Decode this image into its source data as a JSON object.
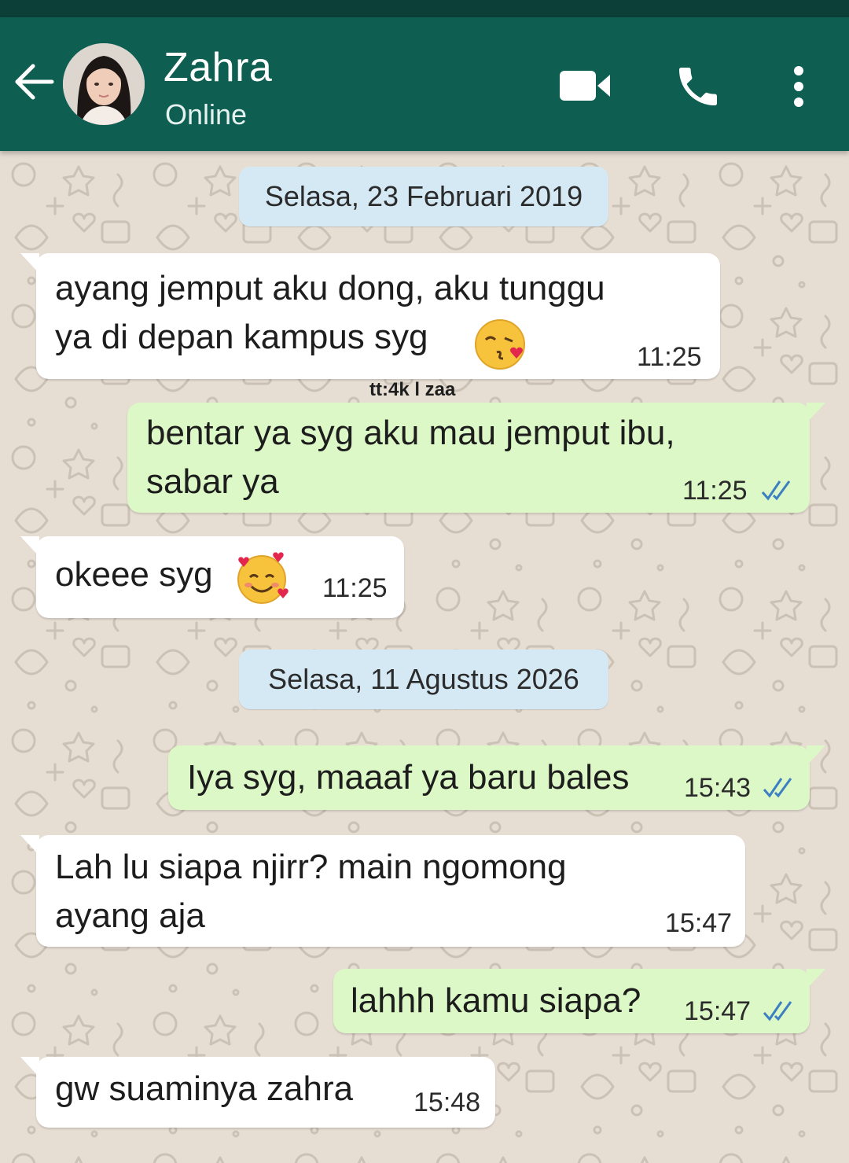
{
  "header": {
    "contact_name": "Zahra",
    "contact_status": "Online"
  },
  "icons": {
    "back": "arrow-left-icon",
    "avatar": "profile-photo",
    "video": "video-camera-icon",
    "call": "phone-icon",
    "menu": "vertical-dots-icon",
    "read_receipt": "double-check-icon",
    "emoji_kiss": "face-blowing-kiss-emoji",
    "emoji_hearts": "smiling-face-with-hearts-emoji"
  },
  "colors": {
    "header_bg": "#0e5e52",
    "chat_bg": "#e6ddd3",
    "incoming_bubble": "#ffffff",
    "outgoing_bubble": "#dcf8c6",
    "date_chip": "#d5e9f4",
    "read_tick": "#3c7fc2"
  },
  "watermark": "tt:4k l zaa",
  "messages": [
    {
      "kind": "date",
      "text": "Selasa, 23 Februari 2019"
    },
    {
      "kind": "in",
      "text": "ayang jemput aku dong, aku tunggu\nya di depan kampus syg",
      "time": "11:25",
      "emoji": "emoji_kiss"
    },
    {
      "kind": "out",
      "text": "bentar ya syg aku mau jemput ibu,\nsabar ya",
      "time": "11:25",
      "read": true
    },
    {
      "kind": "in",
      "text": "okeee syg",
      "time": "11:25",
      "emoji": "emoji_hearts"
    },
    {
      "kind": "date",
      "text": "Selasa, 11 Agustus 2026"
    },
    {
      "kind": "out",
      "text": "Iya syg, maaaf ya baru bales",
      "time": "15:43",
      "read": true
    },
    {
      "kind": "in",
      "text": "Lah lu siapa njirr? main ngomong\nayang aja",
      "time": "15:47"
    },
    {
      "kind": "out",
      "text": "lahhh kamu siapa?",
      "time": "15:47",
      "read": true
    },
    {
      "kind": "in",
      "text": "gw suaminya zahra",
      "time": "15:48"
    }
  ]
}
